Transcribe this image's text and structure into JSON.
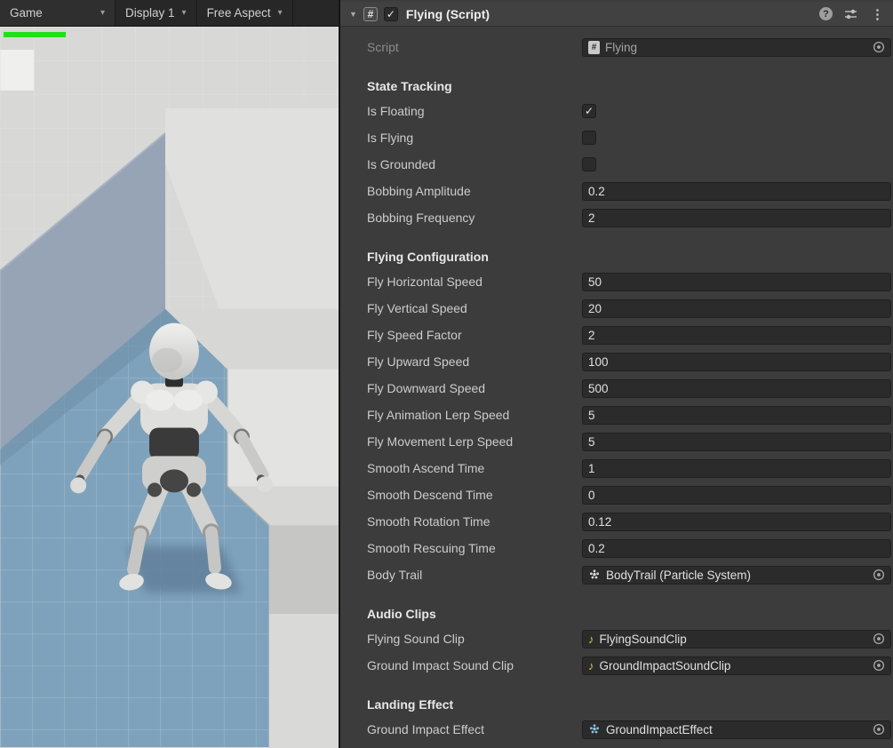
{
  "colors": {
    "accent_green": "#22DF1C",
    "ground_blue": "#7FA2BC",
    "panel_dark": "#3C3C3C",
    "field_dark": "#2B2B2B",
    "audio_icon_yellow": "#E5C84C",
    "effect_icon_blue": "#8CC5E4"
  },
  "icons": {
    "foldout": "▼",
    "caret": "▾",
    "hash": "#",
    "help": "?",
    "kebab": "⋮",
    "note": "♪"
  },
  "game_view": {
    "tab": "Game",
    "display": "Display 1",
    "aspect": "Free Aspect"
  },
  "inspector": {
    "header": {
      "title": "Flying (Script)",
      "enabled": true
    },
    "script_row": {
      "label": "Script",
      "value": "Flying"
    },
    "state_tracking": {
      "title": "State Tracking",
      "is_floating": {
        "label": "Is Floating",
        "checked": true
      },
      "is_flying": {
        "label": "Is Flying",
        "checked": false
      },
      "is_grounded": {
        "label": "Is Grounded",
        "checked": false
      },
      "bobbing_amplitude": {
        "label": "Bobbing Amplitude",
        "value": "0.2"
      },
      "bobbing_frequency": {
        "label": "Bobbing Frequency",
        "value": "2"
      }
    },
    "flying_configuration": {
      "title": "Flying Configuration",
      "rows": [
        {
          "label": "Fly Horizontal Speed",
          "value": "50"
        },
        {
          "label": "Fly Vertical Speed",
          "value": "20"
        },
        {
          "label": "Fly Speed Factor",
          "value": "2"
        },
        {
          "label": "Fly Upward Speed",
          "value": "100"
        },
        {
          "label": "Fly Downward Speed",
          "value": "500"
        },
        {
          "label": "Fly Animation Lerp Speed",
          "value": "5"
        },
        {
          "label": "Fly Movement Lerp Speed",
          "value": "5"
        },
        {
          "label": "Smooth Ascend Time",
          "value": "1"
        },
        {
          "label": "Smooth Descend Time",
          "value": "0"
        },
        {
          "label": "Smooth Rotation Time",
          "value": "0.12"
        },
        {
          "label": "Smooth Rescuing Time",
          "value": "0.2"
        }
      ],
      "body_trail": {
        "label": "Body Trail",
        "value": "BodyTrail (Particle System)"
      }
    },
    "audio_clips": {
      "title": "Audio Clips",
      "flying_sound": {
        "label": "Flying Sound Clip",
        "value": "FlyingSoundClip"
      },
      "ground_impact_sound": {
        "label": "Ground Impact Sound Clip",
        "value": "GroundImpactSoundClip"
      }
    },
    "landing_effect": {
      "title": "Landing Effect",
      "ground_impact_effect": {
        "label": "Ground Impact Effect",
        "value": "GroundImpactEffect"
      }
    }
  }
}
